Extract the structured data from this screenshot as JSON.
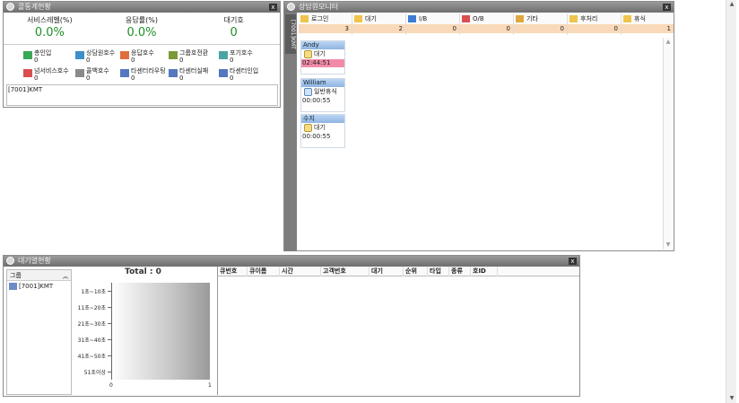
{
  "stats_panel": {
    "title": "콜통계현황",
    "close": "x",
    "metrics": [
      {
        "label": "서비스레벨(%)",
        "value": "0.0%"
      },
      {
        "label": "응답률(%)",
        "value": "0.0%"
      },
      {
        "label": "대기호",
        "value": "0"
      }
    ],
    "counters_row1": [
      {
        "label": "총인입",
        "value": "0",
        "icon": "phone-green-icon"
      },
      {
        "label": "상담원호수",
        "value": "0",
        "icon": "agent-call-icon"
      },
      {
        "label": "응답호수",
        "value": "0",
        "icon": "answer-icon"
      },
      {
        "label": "그룹호전환",
        "value": "0",
        "icon": "group-transfer-icon"
      },
      {
        "label": "포기호수",
        "value": "0",
        "icon": "abandon-icon"
      }
    ],
    "counters_row2": [
      {
        "label": "넘서비스호수",
        "value": "0",
        "icon": "over-service-icon"
      },
      {
        "label": "콜백호수",
        "value": "0",
        "icon": "callback-icon"
      },
      {
        "label": "타센터라우팅",
        "value": "0",
        "icon": "center-route-icon"
      },
      {
        "label": "타센터실패",
        "value": "0",
        "icon": "center-fail-icon"
      },
      {
        "label": "타센터인입",
        "value": "0",
        "icon": "center-in-icon"
      }
    ],
    "log_text": "[7001]KMT"
  },
  "monitor_panel": {
    "title": "상담원모니터",
    "side_tab": "[7001]KMT",
    "status_columns": [
      {
        "label": "로그인",
        "value": "3",
        "icon": "login-icon"
      },
      {
        "label": "대기",
        "value": "2",
        "icon": "wait-icon"
      },
      {
        "label": "I/B",
        "value": "0",
        "icon": "inbound-arrow-icon"
      },
      {
        "label": "O/B",
        "value": "0",
        "icon": "outbound-arrow-icon"
      },
      {
        "label": "기타",
        "value": "0",
        "icon": "etc-icon"
      },
      {
        "label": "후처리",
        "value": "0",
        "icon": "after-work-icon"
      },
      {
        "label": "휴식",
        "value": "1",
        "icon": "rest-icon"
      }
    ],
    "agents": [
      {
        "name": "Andy",
        "status": "대기",
        "time": "02:44:51",
        "highlight": true
      },
      {
        "name": "William",
        "status": "일반휴식",
        "time": "00:00:55",
        "highlight": false
      },
      {
        "name": "수지",
        "status": "대기",
        "time": "00:00:55",
        "highlight": false
      }
    ]
  },
  "queue_panel": {
    "title": "대기열현황",
    "group_header": "그룹",
    "group_items": [
      "[7001]KMT"
    ],
    "table_columns": [
      "큐번호",
      "큐이름",
      "시간",
      "고객번호",
      "대기",
      "순위",
      "타입",
      "종류",
      "호ID"
    ]
  },
  "chart_data": {
    "type": "bar",
    "orientation": "horizontal",
    "title": "Total : 0",
    "categories": [
      "1초~10초",
      "11초~20초",
      "21초~30초",
      "31초~40초",
      "41초~50초",
      "51초이상"
    ],
    "values": [
      0,
      0,
      0,
      0,
      0,
      0
    ],
    "xlim": [
      0,
      1
    ],
    "x_ticks": [
      "0",
      "1"
    ]
  },
  "colors": {
    "green_value": "#1f8f2a",
    "count_band": "#f9d9b8",
    "alert_time": "#f28ba8",
    "agent_header": "#8fb4e0"
  }
}
